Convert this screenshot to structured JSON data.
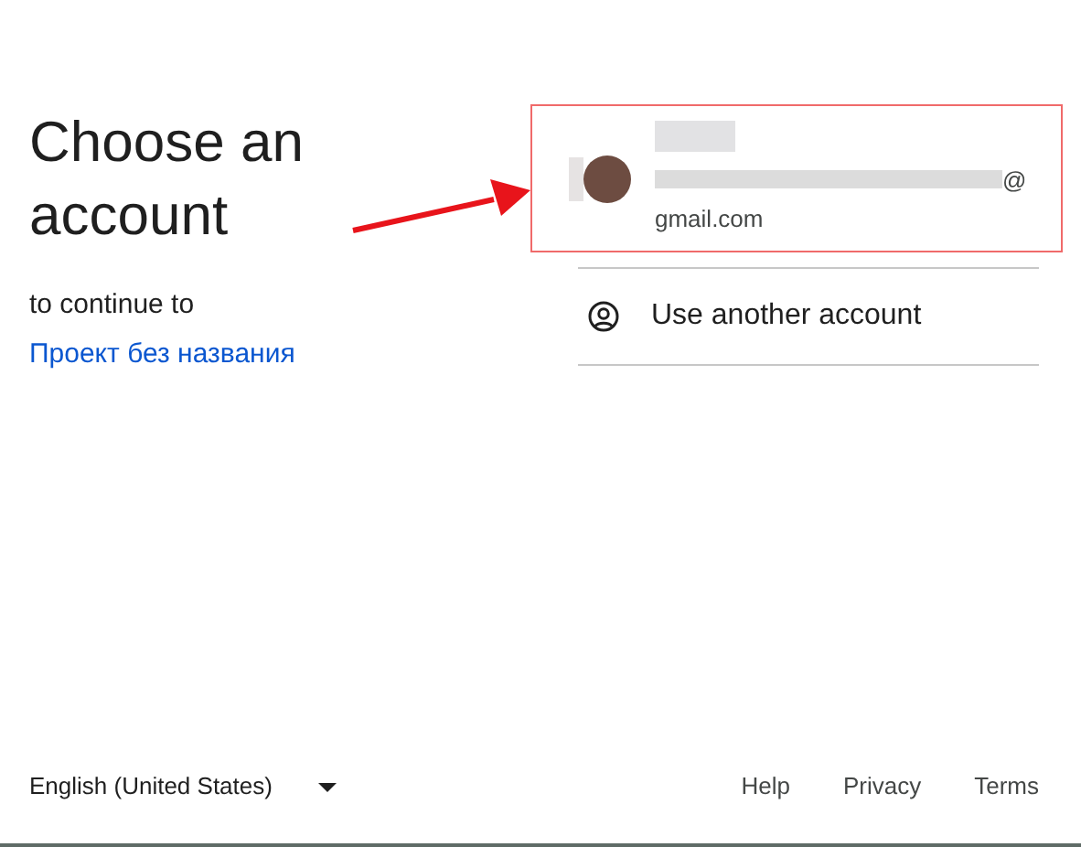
{
  "heading": "Choose an account",
  "subtitle": "to continue to",
  "app_link": "Проект без названия",
  "account": {
    "email_visible": "@",
    "email_domain": "gmail.com"
  },
  "other_account": "Use another account",
  "footer": {
    "language": "English (United States)",
    "links": [
      "Help",
      "Privacy",
      "Terms"
    ]
  }
}
